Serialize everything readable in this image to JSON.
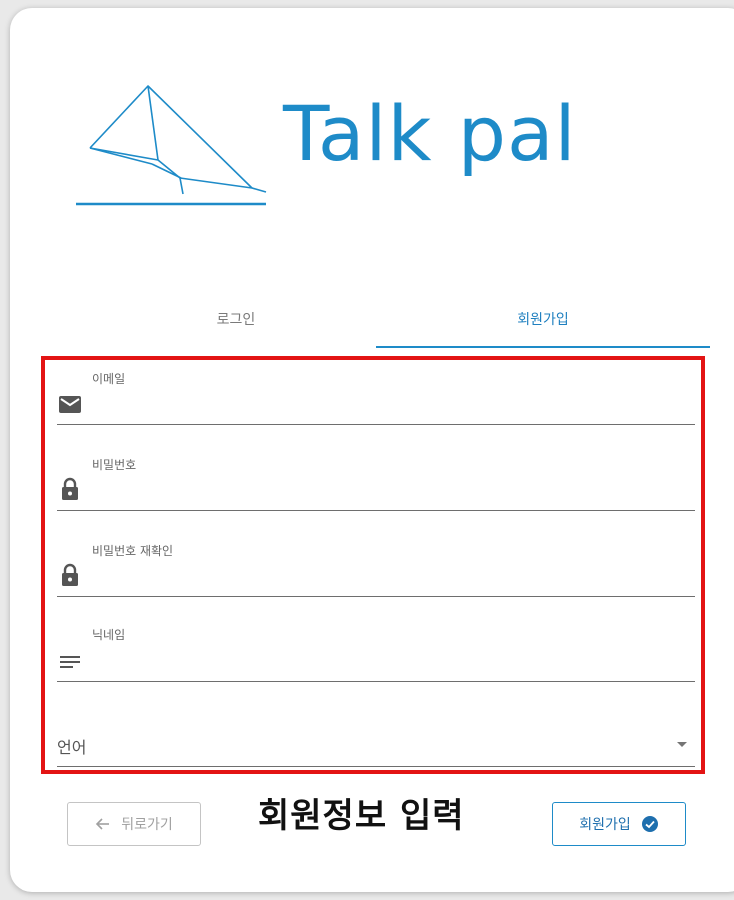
{
  "app": {
    "brand_name": "Talk pal",
    "accent_color": "#1e8bc8"
  },
  "tabs": [
    {
      "label": "로그인",
      "active": false
    },
    {
      "label": "회원가입",
      "active": true
    }
  ],
  "form": {
    "email": {
      "label": "이메일",
      "value": "",
      "icon": "email-icon"
    },
    "password": {
      "label": "비밀번호",
      "value": "",
      "icon": "lock-icon"
    },
    "password_confirm": {
      "label": "비밀번호 재확인",
      "value": "",
      "icon": "lock-icon"
    },
    "nickname": {
      "label": "닉네임",
      "value": "",
      "icon": "text-lines-icon"
    },
    "language": {
      "label": "언어",
      "selected": ""
    }
  },
  "buttons": {
    "back_label": "뒤로가기",
    "back_icon": "arrow-left-icon",
    "signup_label": "회원가입",
    "signup_icon": "check-circle-icon"
  },
  "annotation": {
    "text": "회원정보 입력",
    "highlight_color": "#e31414"
  }
}
